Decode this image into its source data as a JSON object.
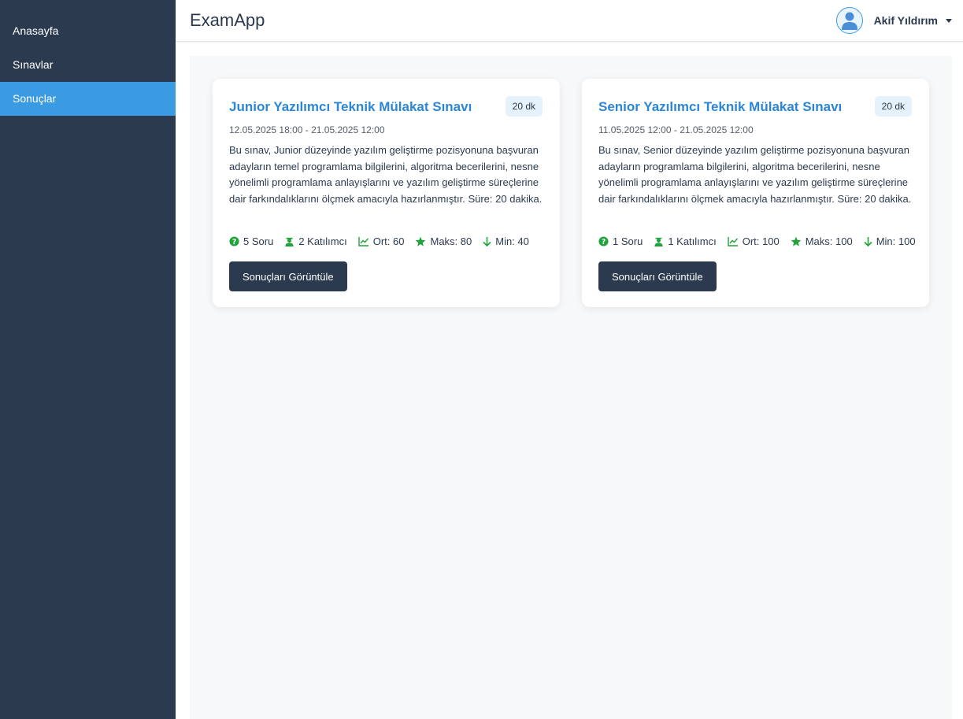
{
  "app": {
    "title": "ExamApp"
  },
  "sidebar": {
    "items": [
      {
        "label": "Anasayfa",
        "active": false
      },
      {
        "label": "Sınavlar",
        "active": false
      },
      {
        "label": "Sonuçlar",
        "active": true
      }
    ]
  },
  "user": {
    "name": "Akif Yıldırım",
    "avatar_icon": "user-avatar-icon",
    "dropdown_icon": "caret-down-icon"
  },
  "colors": {
    "sidebar_bg": "#2c3a4f",
    "active_nav": "#3a9ae2",
    "title_link": "#2c86d6",
    "stat_icon": "#1fa33a",
    "button_bg": "#2c3a4f"
  },
  "exams": [
    {
      "title": "Junior Yazılımcı Teknik Mülakat Sınavı",
      "duration": "20 dk",
      "dates": "12.05.2025 18:00 - 21.05.2025 12:00",
      "description": "Bu sınav, Junior düzeyinde yazılım geliştirme pozisyonuna başvuran adayların temel programlama bilgilerini, algoritma becerilerini, nesne yönelimli programlama anlayışlarını ve yazılım geliştirme süreçlerine dair farkındalıklarını ölçmek amacıyla hazırlanmıştır. Süre: 20 dakika.",
      "stats": {
        "questions": "5 Soru",
        "participants": "2 Katılımcı",
        "average": "Ort: 60",
        "max": "Maks: 80",
        "min": "Min: 40"
      },
      "button_label": "Sonuçları Görüntüle"
    },
    {
      "title": "Senior Yazılımcı Teknik Mülakat Sınavı",
      "duration": "20 dk",
      "dates": "11.05.2025 12:00 - 21.05.2025 12:00",
      "description": "Bu sınav, Senior düzeyinde yazılım geliştirme pozisyonuna başvuran adayların programlama bilgilerini, algoritma becerilerini, nesne yönelimli programlama anlayışlarını ve yazılım geliştirme süreçlerine dair farkındalıklarını ölçmek amacıyla hazırlanmıştır. Süre: 20 dakika.",
      "stats": {
        "questions": "1 Soru",
        "participants": "1 Katılımcı",
        "average": "Ort: 100",
        "max": "Maks: 100",
        "min": "Min: 100"
      },
      "button_label": "Sonuçları Görüntüle"
    }
  ]
}
